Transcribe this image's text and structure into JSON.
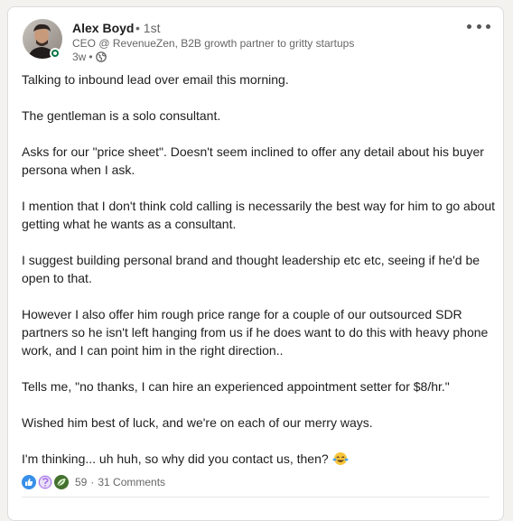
{
  "post": {
    "author": {
      "name": "Alex Boyd",
      "degree": "• 1st",
      "headline": "CEO @ RevenueZen, B2B growth partner to gritty startups",
      "time_ago": "3w",
      "separator": "•",
      "visibility_icon": "globe-icon",
      "status": "online"
    },
    "more_icon": "more-horizontal-icon",
    "paragraphs": [
      "Talking to inbound lead over email this morning.",
      "The gentleman is a solo consultant.",
      "Asks for our \"price sheet\". Doesn't seem inclined to offer any detail about his buyer persona when I ask.",
      "I mention that I don't think cold calling is necessarily the best way for him to go about getting what he wants as a consultant.",
      "I suggest building personal brand and thought leadership etc etc, seeing if he'd be open to that.",
      "However I also offer him rough price range for a couple of our outsourced SDR partners so he isn't left hanging from us if he does want to do this with heavy phone work, and I can point him in the right direction..",
      "Tells me, \"no thanks, I can hire an experienced appointment setter for $8/hr.\"",
      "Wished him best of luck, and we're on each of our merry ways."
    ],
    "last_paragraph": "I'm thinking... uh huh, so why did you contact us, then?",
    "last_paragraph_emoji": "laughing-crying-emoji",
    "social": {
      "reactions": [
        "like-reaction-icon",
        "curious-reaction-icon",
        "insightful-reaction-icon"
      ],
      "reaction_count": "59",
      "separator": "·",
      "comments": "31 Comments"
    }
  },
  "colors": {
    "online": "#057642",
    "like": "#378fe9",
    "curious": "#a872e8",
    "insightful": "#44712e",
    "muted_text": "#666666"
  }
}
